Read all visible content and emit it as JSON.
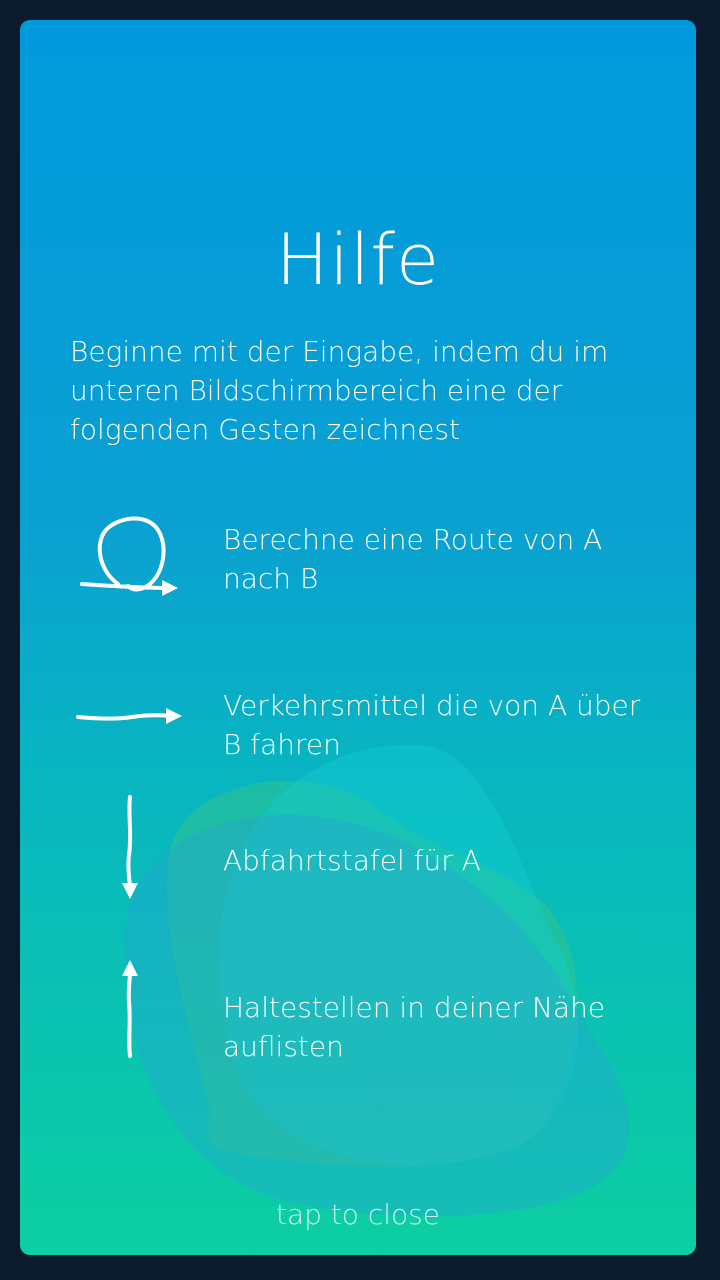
{
  "help": {
    "title": "Hilfe",
    "intro": "Beginne mit der Eingabe, indem du im unteren Bildschirmbereich eine der folgenden Gesten zeichnest",
    "gestures": [
      {
        "icon": "loop-arrow-gesture-icon",
        "label": "Berechne eine Route von A nach B"
      },
      {
        "icon": "right-arrow-gesture-icon",
        "label": "Verkehrsmittel die von A über B fahren"
      },
      {
        "icon": "down-arrow-gesture-icon",
        "label": "Abfahrtstafel für A"
      },
      {
        "icon": "up-arrow-gesture-icon",
        "label": "Haltestellen in deiner Nähe auflisten"
      }
    ],
    "close_hint": "tap to close"
  },
  "colors": {
    "page_background": "#0b1a2c",
    "gradient_top": "#0099dc",
    "gradient_bottom": "#0ccfa2",
    "text": "#ffffff"
  }
}
